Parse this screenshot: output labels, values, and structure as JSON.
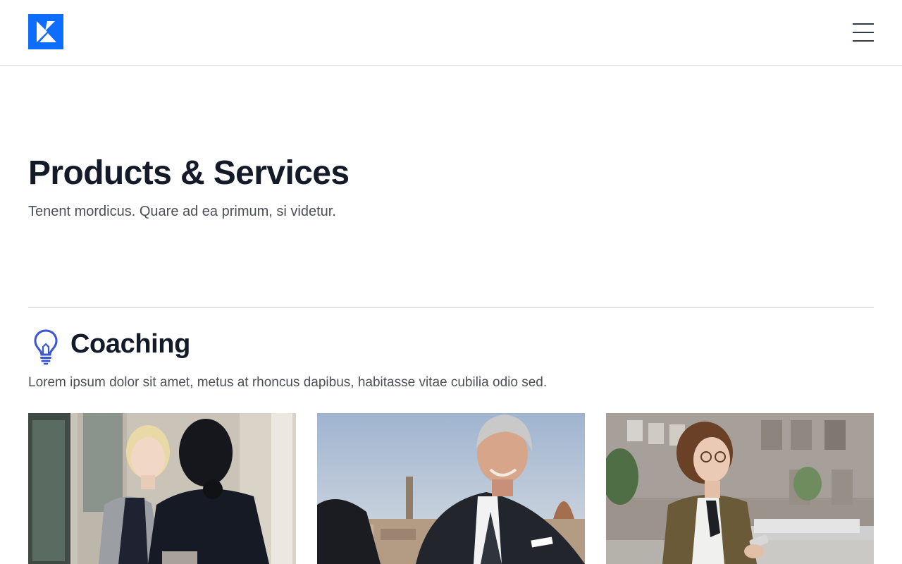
{
  "header": {
    "logo_icon": "brand-logo-icon",
    "menu_icon": "hamburger-menu-icon",
    "brand_color": "#0d6efd"
  },
  "hero": {
    "title": "Products & Services",
    "subtitle": "Tenent mordicus. Quare ad ea primum, si videtur."
  },
  "section": {
    "icon": "lightbulb-icon",
    "icon_color": "#3a55d6",
    "title": "Coaching",
    "description": "Lorem ipsum dolor sit amet, metus at rhoncus dapibus, habitasse vitae cubilia odio sed."
  },
  "cards": [
    {
      "image": "photo-two-women-talking"
    },
    {
      "image": "photo-smiling-senior-man"
    },
    {
      "image": "photo-woman-with-phone-on-street"
    }
  ]
}
